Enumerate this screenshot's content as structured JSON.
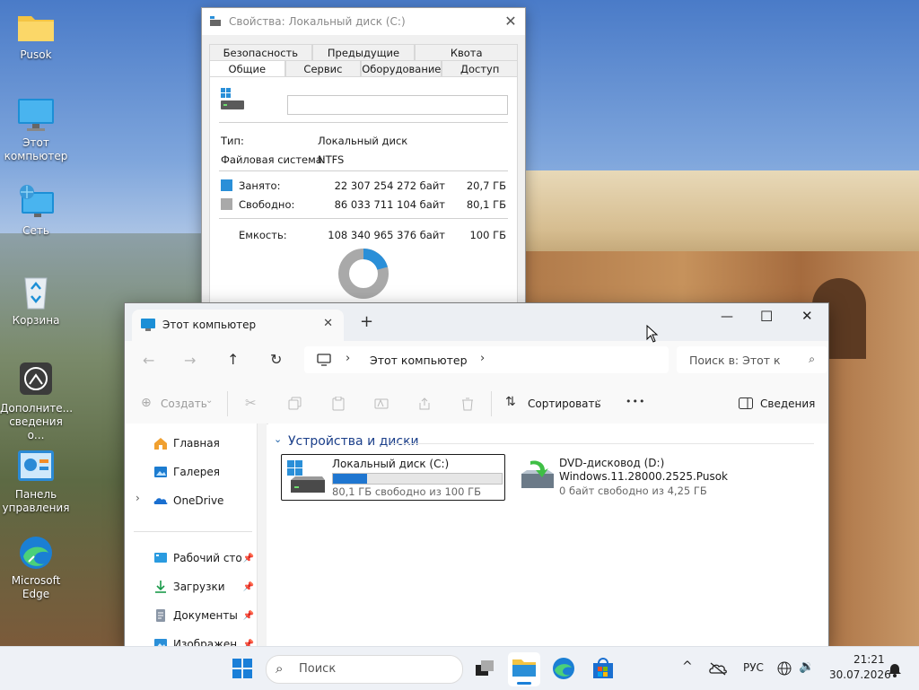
{
  "desktop": {
    "icons": [
      {
        "label": "Pusok",
        "icon": "folder-icon"
      },
      {
        "label": "Этот\nкомпьютер",
        "icon": "monitor-icon"
      },
      {
        "label": "Сеть",
        "icon": "network-icon"
      },
      {
        "label": "Корзина",
        "icon": "recycle-bin-icon"
      },
      {
        "label": "Дополните...\nсведения о...",
        "icon": "info-icon"
      },
      {
        "label": "Панель\nуправления",
        "icon": "control-panel-icon"
      },
      {
        "label": "Microsoft\nEdge",
        "icon": "edge-icon"
      }
    ]
  },
  "properties": {
    "title": "Свойства: Локальный диск (C:)",
    "tabs_row1": [
      "Безопасность",
      "Предыдущие версии",
      "Квота"
    ],
    "tabs_row2": [
      "Общие",
      "Сервис",
      "Оборудование",
      "Доступ"
    ],
    "active_tab": "Общие",
    "name_value": "",
    "type_label": "Тип:",
    "type_value": "Локальный диск",
    "fs_label": "Файловая система:",
    "fs_value": "NTFS",
    "used_label": "Занято:",
    "used_bytes": "22 307 254 272 байт",
    "used_gb": "20,7 ГБ",
    "free_label": "Свободно:",
    "free_bytes": "86 033 711 104 байт",
    "free_gb": "80,1 ГБ",
    "capacity_label": "Емкость:",
    "capacity_bytes": "108 340 965 376 байт",
    "capacity_gb": "100 ГБ",
    "used_fraction": 0.206,
    "colors": {
      "used": "#2a8fd8",
      "free": "#a9a9a9"
    }
  },
  "explorer": {
    "tab_title": "Этот компьютер",
    "new_tab": "+",
    "window_controls": {
      "minimize": "—",
      "maximize": "☐",
      "close": "✕"
    },
    "breadcrumb": "Этот компьютер",
    "search_placeholder": "Поиск в: Этот к",
    "commands": {
      "create": "Создать",
      "sort": "Сортировать",
      "more": "•••",
      "details": "Сведения"
    },
    "sidebar": [
      {
        "label": "Главная",
        "icon": "home-icon"
      },
      {
        "label": "Галерея",
        "icon": "gallery-icon"
      },
      {
        "label": "OneDrive",
        "icon": "onedrive-icon"
      },
      {
        "label": "Рабочий сто",
        "icon": "desktop-folder-icon"
      },
      {
        "label": "Загрузки",
        "icon": "downloads-icon"
      },
      {
        "label": "Документы",
        "icon": "documents-icon"
      },
      {
        "label": "Изображен",
        "icon": "pictures-icon"
      }
    ],
    "section_header": "Устройства и диски",
    "drives": [
      {
        "name": "Локальный диск (C:)",
        "free_text": "80,1 ГБ свободно из 100 ГБ",
        "used_fraction": 0.2
      },
      {
        "name": "DVD-дисковод (D:)",
        "volume": "Windows.11.28000.2525.Pusok",
        "free_text": "0 байт свободно из 4,25 ГБ"
      }
    ]
  },
  "taskbar": {
    "search_placeholder": "Поиск",
    "language": "РУС",
    "time": "21:21",
    "date": "30.07.2026"
  }
}
